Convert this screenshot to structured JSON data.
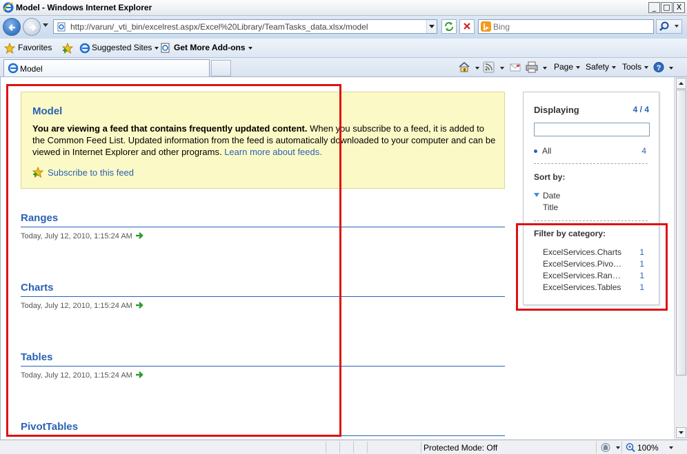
{
  "window": {
    "title": "Model - Windows Internet Explorer",
    "minimize": "_",
    "restore": "□",
    "close": "X"
  },
  "address": {
    "url": "http://varun/_vti_bin/excelrest.aspx/Excel%20Library/TeamTasks_data.xlsx/model"
  },
  "search": {
    "placeholder": "Bing"
  },
  "favorites": {
    "favorites_label": "Favorites",
    "suggested_sites": "Suggested Sites",
    "get_more_addons": "Get More Add-ons"
  },
  "tab": {
    "label": "Model"
  },
  "commands": {
    "page": "Page",
    "safety": "Safety",
    "tools": "Tools"
  },
  "feed": {
    "title": "Model",
    "desc_bold": "You are viewing a feed that contains frequently updated content.",
    "desc_rest": " When you subscribe to a feed, it is added to the Common Feed List. Updated information from the feed is automatically downloaded to your computer and can be viewed in Internet Explorer and other programs. ",
    "learn_more": "Learn more about feeds.",
    "subscribe": "Subscribe to this feed"
  },
  "entries": [
    {
      "title": "Ranges",
      "date": "Today, July 12, 2010, 1:15:24 AM"
    },
    {
      "title": "Charts",
      "date": "Today, July 12, 2010, 1:15:24 AM"
    },
    {
      "title": "Tables",
      "date": "Today, July 12, 2010, 1:15:24 AM"
    },
    {
      "title": "PivotTables",
      "date": ""
    }
  ],
  "sidebar": {
    "displaying": "Displaying",
    "count": "4 / 4",
    "all_label": "All",
    "all_count": "4",
    "sort_by": "Sort by:",
    "sort_date": "Date",
    "sort_title": "Title",
    "filter_by": "Filter by category:",
    "categories": [
      {
        "label": "ExcelServices.Charts",
        "count": "1"
      },
      {
        "label": "ExcelServices.PivotTables",
        "count": "1"
      },
      {
        "label": "ExcelServices.Ranges",
        "count": "1"
      },
      {
        "label": "ExcelServices.Tables",
        "count": "1"
      }
    ]
  },
  "status": {
    "protected_mode": "Protected Mode: Off",
    "zoom": "100%"
  },
  "colors": {
    "link_blue": "#2a62b4",
    "feed_box": "#fbf9c6",
    "highlight_red": "#e01010"
  }
}
